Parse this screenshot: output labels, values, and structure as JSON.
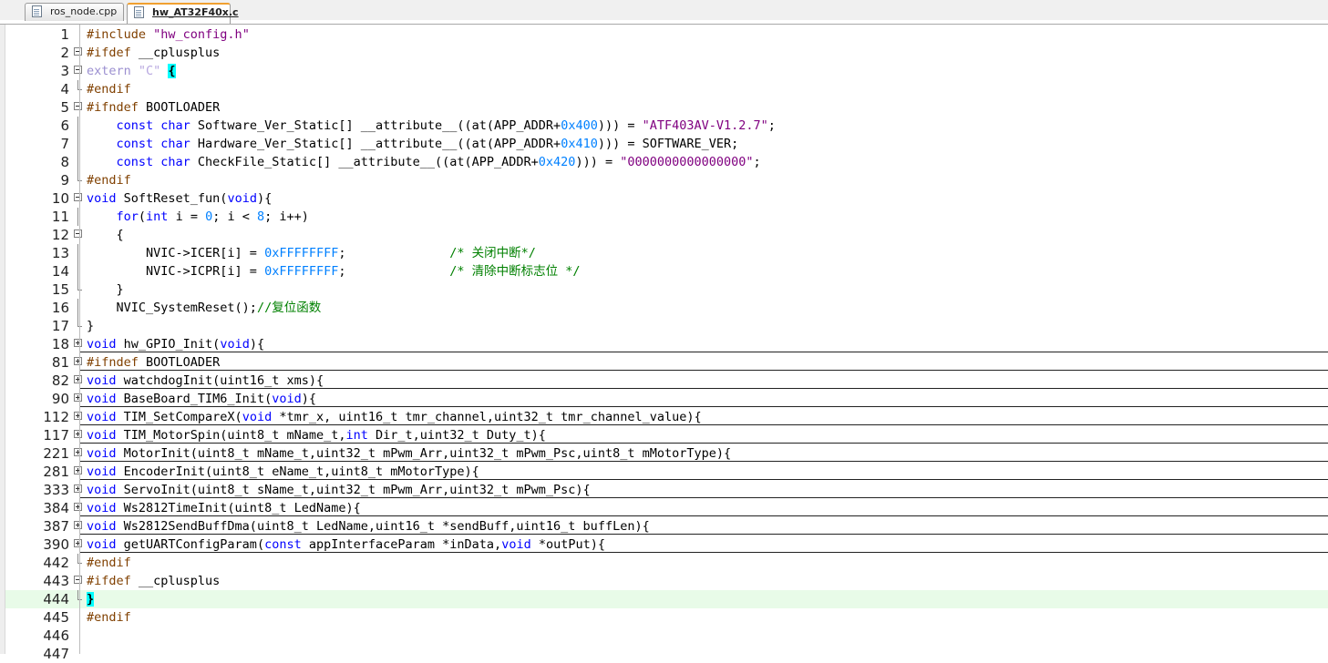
{
  "tabs": [
    {
      "label": "ros_node.cpp",
      "active": false
    },
    {
      "label": "hw_AT32F40x.c",
      "active": true
    }
  ],
  "colors": {
    "keyword": "#0000ff",
    "preprocessor": "#804000",
    "string": "#800080",
    "number": "#0080ff",
    "comment": "#008000",
    "brace_match": "#00ffff",
    "current_line": "#e8fbe8"
  },
  "lines": [
    {
      "num": "1",
      "fold": "",
      "tokens": [
        [
          "pp",
          "#include "
        ],
        [
          "str",
          "\"hw_config.h\""
        ]
      ]
    },
    {
      "num": "2",
      "fold": "minus",
      "tokens": [
        [
          "pp",
          "#ifdef "
        ],
        [
          "pl",
          "__cplusplus"
        ]
      ]
    },
    {
      "num": "3",
      "fold": "minus",
      "tokens": [
        [
          "ext",
          "extern "
        ],
        [
          "extstr",
          "\"C\" "
        ],
        [
          "brc",
          "{"
        ]
      ]
    },
    {
      "num": "4",
      "fold": "end",
      "tokens": [
        [
          "pp",
          "#endif"
        ]
      ]
    },
    {
      "num": "5",
      "fold": "minus",
      "tokens": [
        [
          "pp",
          "#ifndef "
        ],
        [
          "pl",
          "BOOTLOADER"
        ]
      ]
    },
    {
      "num": "6",
      "fold": "line",
      "tokens": [
        [
          "pl",
          "    "
        ],
        [
          "kw",
          "const char "
        ],
        [
          "pl",
          "Software_Ver_Static[] __attribute__((at(APP_ADDR+"
        ],
        [
          "num",
          "0x400"
        ],
        [
          "pl",
          "))) = "
        ],
        [
          "str",
          "\"ATF403AV-V1.2.7\""
        ],
        [
          "pl",
          ";"
        ]
      ]
    },
    {
      "num": "7",
      "fold": "line",
      "tokens": [
        [
          "pl",
          "    "
        ],
        [
          "kw",
          "const char "
        ],
        [
          "pl",
          "Hardware_Ver_Static[] __attribute__((at(APP_ADDR+"
        ],
        [
          "num",
          "0x410"
        ],
        [
          "pl",
          "))) = SOFTWARE_VER;"
        ]
      ]
    },
    {
      "num": "8",
      "fold": "line",
      "tokens": [
        [
          "pl",
          "    "
        ],
        [
          "kw",
          "const char "
        ],
        [
          "pl",
          "CheckFile_Static[] __attribute__((at(APP_ADDR+"
        ],
        [
          "num",
          "0x420"
        ],
        [
          "pl",
          "))) = "
        ],
        [
          "str",
          "\"0000000000000000\""
        ],
        [
          "pl",
          ";"
        ]
      ]
    },
    {
      "num": "9",
      "fold": "end",
      "tokens": [
        [
          "pp",
          "#endif"
        ]
      ]
    },
    {
      "num": "10",
      "fold": "minus",
      "tokens": [
        [
          "kw",
          "void "
        ],
        [
          "pl",
          "SoftReset_fun("
        ],
        [
          "kw",
          "void"
        ],
        [
          "pl",
          "){"
        ]
      ]
    },
    {
      "num": "11",
      "fold": "line",
      "tokens": [
        [
          "pl",
          "    "
        ],
        [
          "kw",
          "for"
        ],
        [
          "pl",
          "("
        ],
        [
          "kw",
          "int "
        ],
        [
          "pl",
          "i = "
        ],
        [
          "num",
          "0"
        ],
        [
          "pl",
          "; i < "
        ],
        [
          "num",
          "8"
        ],
        [
          "pl",
          "; i++)"
        ]
      ]
    },
    {
      "num": "12",
      "fold": "minus",
      "tokens": [
        [
          "pl",
          "    {"
        ]
      ]
    },
    {
      "num": "13",
      "fold": "line",
      "tokens": [
        [
          "pl",
          "        NVIC->ICER[i] = "
        ],
        [
          "num",
          "0xFFFFFFFF"
        ],
        [
          "pl",
          ";              "
        ],
        [
          "cm",
          "/* 关闭中断*/"
        ]
      ]
    },
    {
      "num": "14",
      "fold": "line",
      "tokens": [
        [
          "pl",
          "        NVIC->ICPR[i] = "
        ],
        [
          "num",
          "0xFFFFFFFF"
        ],
        [
          "pl",
          ";              "
        ],
        [
          "cm",
          "/* 清除中断标志位 */"
        ]
      ]
    },
    {
      "num": "15",
      "fold": "end",
      "tokens": [
        [
          "pl",
          "    }"
        ]
      ]
    },
    {
      "num": "16",
      "fold": "line",
      "tokens": [
        [
          "pl",
          "    NVIC_SystemReset();"
        ],
        [
          "cm",
          "//复位函数"
        ]
      ]
    },
    {
      "num": "17",
      "fold": "end",
      "tokens": [
        [
          "pl",
          "}"
        ]
      ]
    },
    {
      "num": "18",
      "fold": "plus",
      "collapsed": true,
      "tokens": [
        [
          "kw",
          "void "
        ],
        [
          "pl",
          "hw_GPIO_Init("
        ],
        [
          "kw",
          "void"
        ],
        [
          "pl",
          "){"
        ]
      ]
    },
    {
      "num": "81",
      "fold": "plus",
      "collapsed": true,
      "tokens": [
        [
          "pp",
          "#ifndef "
        ],
        [
          "pl",
          "BOOTLOADER"
        ]
      ]
    },
    {
      "num": "82",
      "fold": "plus",
      "collapsed": true,
      "tokens": [
        [
          "kw",
          "void "
        ],
        [
          "pl",
          "watchdogInit(uint16_t xms){"
        ]
      ]
    },
    {
      "num": "90",
      "fold": "plus",
      "collapsed": true,
      "tokens": [
        [
          "kw",
          "void "
        ],
        [
          "pl",
          "BaseBoard_TIM6_Init("
        ],
        [
          "kw",
          "void"
        ],
        [
          "pl",
          "){"
        ]
      ]
    },
    {
      "num": "112",
      "fold": "plus",
      "collapsed": true,
      "tokens": [
        [
          "kw",
          "void "
        ],
        [
          "pl",
          "TIM_SetCompareX("
        ],
        [
          "kw",
          "void "
        ],
        [
          "pl",
          "*tmr_x, uint16_t tmr_channel,uint32_t tmr_channel_value){"
        ]
      ]
    },
    {
      "num": "117",
      "fold": "plus",
      "collapsed": true,
      "tokens": [
        [
          "kw",
          "void "
        ],
        [
          "pl",
          "TIM_MotorSpin(uint8_t mName_t,"
        ],
        [
          "kw",
          "int "
        ],
        [
          "pl",
          "Dir_t,uint32_t Duty_t){"
        ]
      ]
    },
    {
      "num": "221",
      "fold": "plus",
      "collapsed": true,
      "tokens": [
        [
          "kw",
          "void "
        ],
        [
          "pl",
          "MotorInit(uint8_t mName_t,uint32_t mPwm_Arr,uint32_t mPwm_Psc,uint8_t mMotorType){"
        ]
      ]
    },
    {
      "num": "281",
      "fold": "plus",
      "collapsed": true,
      "tokens": [
        [
          "kw",
          "void "
        ],
        [
          "pl",
          "EncoderInit(uint8_t eName_t,uint8_t mMotorType){"
        ]
      ]
    },
    {
      "num": "333",
      "fold": "plus",
      "collapsed": true,
      "tokens": [
        [
          "kw",
          "void "
        ],
        [
          "pl",
          "ServoInit(uint8_t sName_t,uint32_t mPwm_Arr,uint32_t mPwm_Psc){"
        ]
      ]
    },
    {
      "num": "384",
      "fold": "plus",
      "collapsed": true,
      "tokens": [
        [
          "kw",
          "void "
        ],
        [
          "pl",
          "Ws2812TimeInit(uint8_t LedName){"
        ]
      ]
    },
    {
      "num": "387",
      "fold": "plus",
      "collapsed": true,
      "tokens": [
        [
          "kw",
          "void "
        ],
        [
          "pl",
          "Ws2812SendBuffDma(uint8_t LedName,uint16_t *sendBuff,uint16_t buffLen){"
        ]
      ]
    },
    {
      "num": "390",
      "fold": "plus",
      "collapsed": true,
      "tokens": [
        [
          "kw",
          "void "
        ],
        [
          "pl",
          "getUARTConfigParam("
        ],
        [
          "kw",
          "const "
        ],
        [
          "pl",
          "appInterfaceParam *inData,"
        ],
        [
          "kw",
          "void "
        ],
        [
          "pl",
          "*outPut){"
        ]
      ]
    },
    {
      "num": "442",
      "fold": "end",
      "tokens": [
        [
          "pp",
          "#endif"
        ]
      ]
    },
    {
      "num": "443",
      "fold": "minus",
      "tokens": [
        [
          "pp",
          "#ifdef "
        ],
        [
          "pl",
          "__cplusplus"
        ]
      ]
    },
    {
      "num": "444",
      "fold": "end",
      "highlight": true,
      "tokens": [
        [
          "brc",
          "}"
        ]
      ]
    },
    {
      "num": "445",
      "fold": "",
      "tokens": [
        [
          "pp",
          "#endif"
        ]
      ]
    },
    {
      "num": "446",
      "fold": "",
      "tokens": []
    },
    {
      "num": "447",
      "fold": "",
      "tokens": []
    }
  ]
}
